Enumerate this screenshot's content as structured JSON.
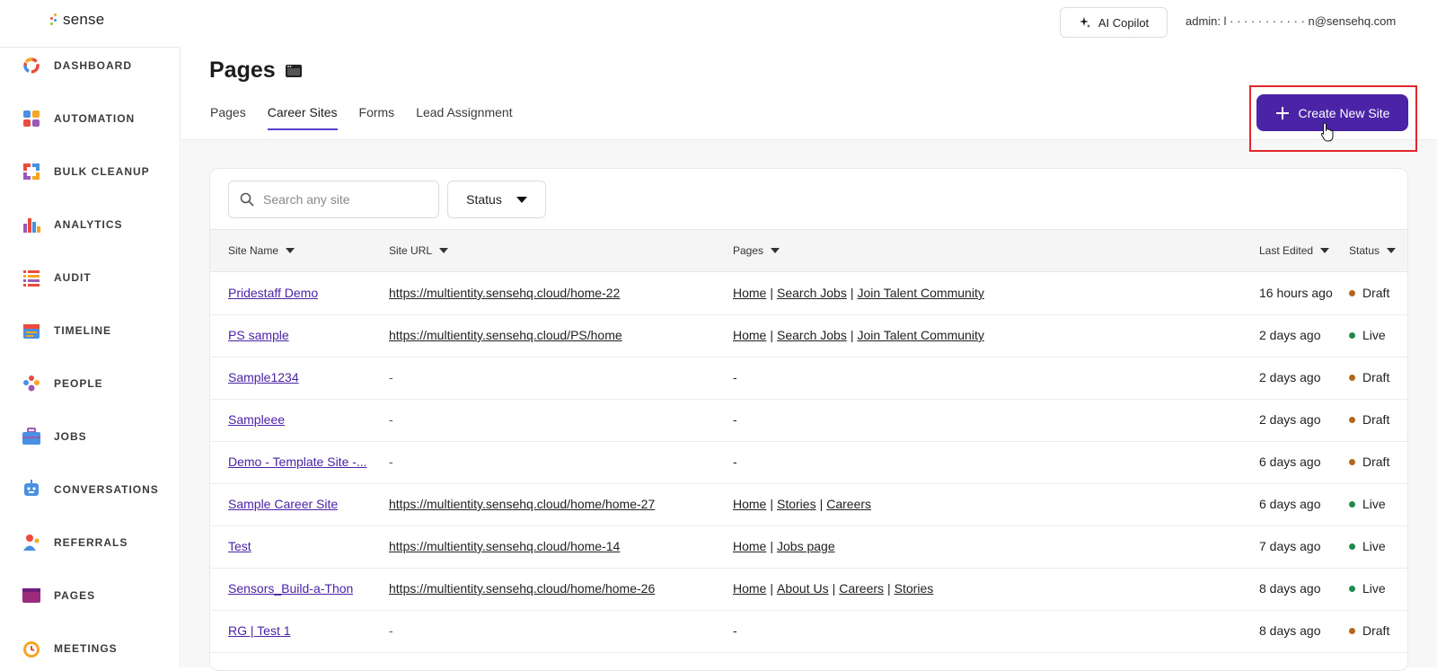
{
  "app": {
    "logo_text": "sense",
    "copilot_label": "AI Copilot",
    "admin_label": "admin: l · · · · · · · · · · · n@sensehq.com"
  },
  "sidebar": {
    "items": [
      {
        "label": "DASHBOARD",
        "icon": "dashboard-icon"
      },
      {
        "label": "AUTOMATION",
        "icon": "automation-icon"
      },
      {
        "label": "BULK CLEANUP",
        "icon": "bulk-cleanup-icon"
      },
      {
        "label": "ANALYTICS",
        "icon": "analytics-icon"
      },
      {
        "label": "AUDIT",
        "icon": "audit-icon"
      },
      {
        "label": "TIMELINE",
        "icon": "timeline-icon"
      },
      {
        "label": "PEOPLE",
        "icon": "people-icon"
      },
      {
        "label": "JOBS",
        "icon": "jobs-icon"
      },
      {
        "label": "CONVERSATIONS",
        "icon": "conversations-icon"
      },
      {
        "label": "REFERRALS",
        "icon": "referrals-icon"
      },
      {
        "label": "PAGES",
        "icon": "pages-icon"
      },
      {
        "label": "MEETINGS",
        "icon": "meetings-icon"
      }
    ]
  },
  "header": {
    "title": "Pages",
    "tabs": [
      "Pages",
      "Career Sites",
      "Forms",
      "Lead Assignment"
    ],
    "active_tab": "Career Sites",
    "create_button": "Create New Site"
  },
  "filters": {
    "search_placeholder": "Search any site",
    "status_label": "Status"
  },
  "table": {
    "columns": [
      "Site Name",
      "Site URL",
      "Pages",
      "Last Edited",
      "Status"
    ],
    "rows": [
      {
        "name": "Pridestaff Demo",
        "url": "https://multientity.sensehq.cloud/home-22",
        "pages": [
          "Home",
          "Search Jobs",
          "Join Talent Community"
        ],
        "edited": "16 hours ago",
        "status": "Draft"
      },
      {
        "name": "PS sample",
        "url": "https://multientity.sensehq.cloud/PS/home",
        "pages": [
          "Home",
          "Search Jobs",
          "Join Talent Community"
        ],
        "edited": "2 days ago",
        "status": "Live"
      },
      {
        "name": "Sample1234",
        "url": "-",
        "pages": [],
        "pages_empty": "-",
        "edited": "2 days ago",
        "status": "Draft"
      },
      {
        "name": "Sampleee",
        "url": "-",
        "pages": [],
        "pages_empty": "-",
        "edited": "2 days ago",
        "status": "Draft"
      },
      {
        "name": "Demo - Template Site -...",
        "url": "-",
        "pages": [],
        "pages_empty": "-",
        "edited": "6 days ago",
        "status": "Draft"
      },
      {
        "name": "Sample Career Site",
        "url": "https://multientity.sensehq.cloud/home/home-27",
        "pages": [
          "Home",
          "Stories",
          "Careers"
        ],
        "edited": "6 days ago",
        "status": "Live"
      },
      {
        "name": "Test",
        "url": "https://multientity.sensehq.cloud/home-14",
        "pages": [
          "Home",
          "Jobs page"
        ],
        "edited": "7 days ago",
        "status": "Live"
      },
      {
        "name": "Sensors_Build-a-Thon",
        "url": "https://multientity.sensehq.cloud/home/home-26",
        "pages": [
          "Home",
          "About Us",
          "Careers",
          "Stories"
        ],
        "edited": "8 days ago",
        "status": "Live"
      },
      {
        "name": "RG | Test 1",
        "url": "-",
        "pages": [],
        "pages_empty": "-",
        "edited": "8 days ago",
        "status": "Draft"
      }
    ]
  },
  "colors": {
    "accent": "#4a23a6",
    "draft": "#b5651d",
    "live": "#1e8a4c",
    "highlight": "#e0272f"
  }
}
